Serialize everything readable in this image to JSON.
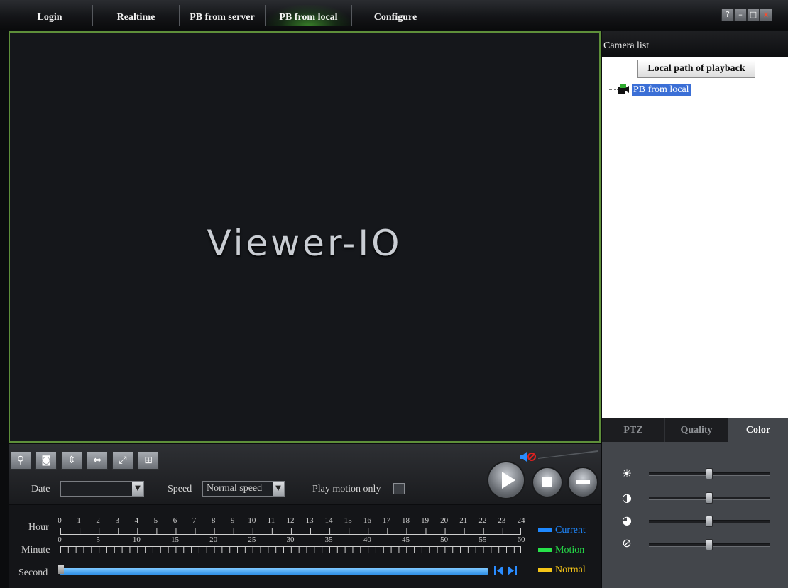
{
  "nav": {
    "tabs": [
      {
        "label": "Login"
      },
      {
        "label": "Realtime"
      },
      {
        "label": "PB from server"
      },
      {
        "label": "PB from local"
      },
      {
        "label": "Configure"
      }
    ],
    "active_tab": "PB from local",
    "window_buttons": {
      "help": "?",
      "minimize": "–",
      "maximize": "□",
      "close": "×"
    }
  },
  "video": {
    "logo_text": "Viewer-IO"
  },
  "controls": {
    "date_label": "Date",
    "date_value": "",
    "speed_label": "Speed",
    "speed_value": "Normal speed",
    "play_motion_label": "Play motion only",
    "play_motion_checked": false,
    "volume_muted": true
  },
  "timeline": {
    "hour_label": "Hour",
    "minute_label": "Minute",
    "second_label": "Second",
    "hour_ticks": [
      "0",
      "1",
      "2",
      "3",
      "4",
      "5",
      "6",
      "7",
      "8",
      "9",
      "10",
      "11",
      "12",
      "13",
      "14",
      "15",
      "16",
      "17",
      "18",
      "19",
      "20",
      "21",
      "22",
      "23",
      "24"
    ],
    "minute_ticks": [
      "0",
      "5",
      "10",
      "15",
      "20",
      "25",
      "30",
      "35",
      "40",
      "45",
      "50",
      "55",
      "60"
    ],
    "legend": [
      {
        "label": "Current",
        "color": "#1e88ff"
      },
      {
        "label": "Motion",
        "color": "#27e24a"
      },
      {
        "label": "Normal",
        "color": "#f5c518"
      }
    ]
  },
  "right_panel": {
    "camera_list_title": "Camera list",
    "local_path_button": "Local path of playback",
    "tree_item": "PB from local",
    "tabs": [
      {
        "label": "PTZ"
      },
      {
        "label": "Quality"
      },
      {
        "label": "Color"
      }
    ],
    "active_tab": "Color",
    "sliders": [
      {
        "name": "brightness",
        "icon": "sun-icon",
        "value": 0.5
      },
      {
        "name": "contrast",
        "icon": "contrast-icon",
        "value": 0.5
      },
      {
        "name": "saturation",
        "icon": "saturation-icon",
        "value": 0.5
      },
      {
        "name": "hue",
        "icon": "hue-icon",
        "value": 0.5
      }
    ]
  }
}
